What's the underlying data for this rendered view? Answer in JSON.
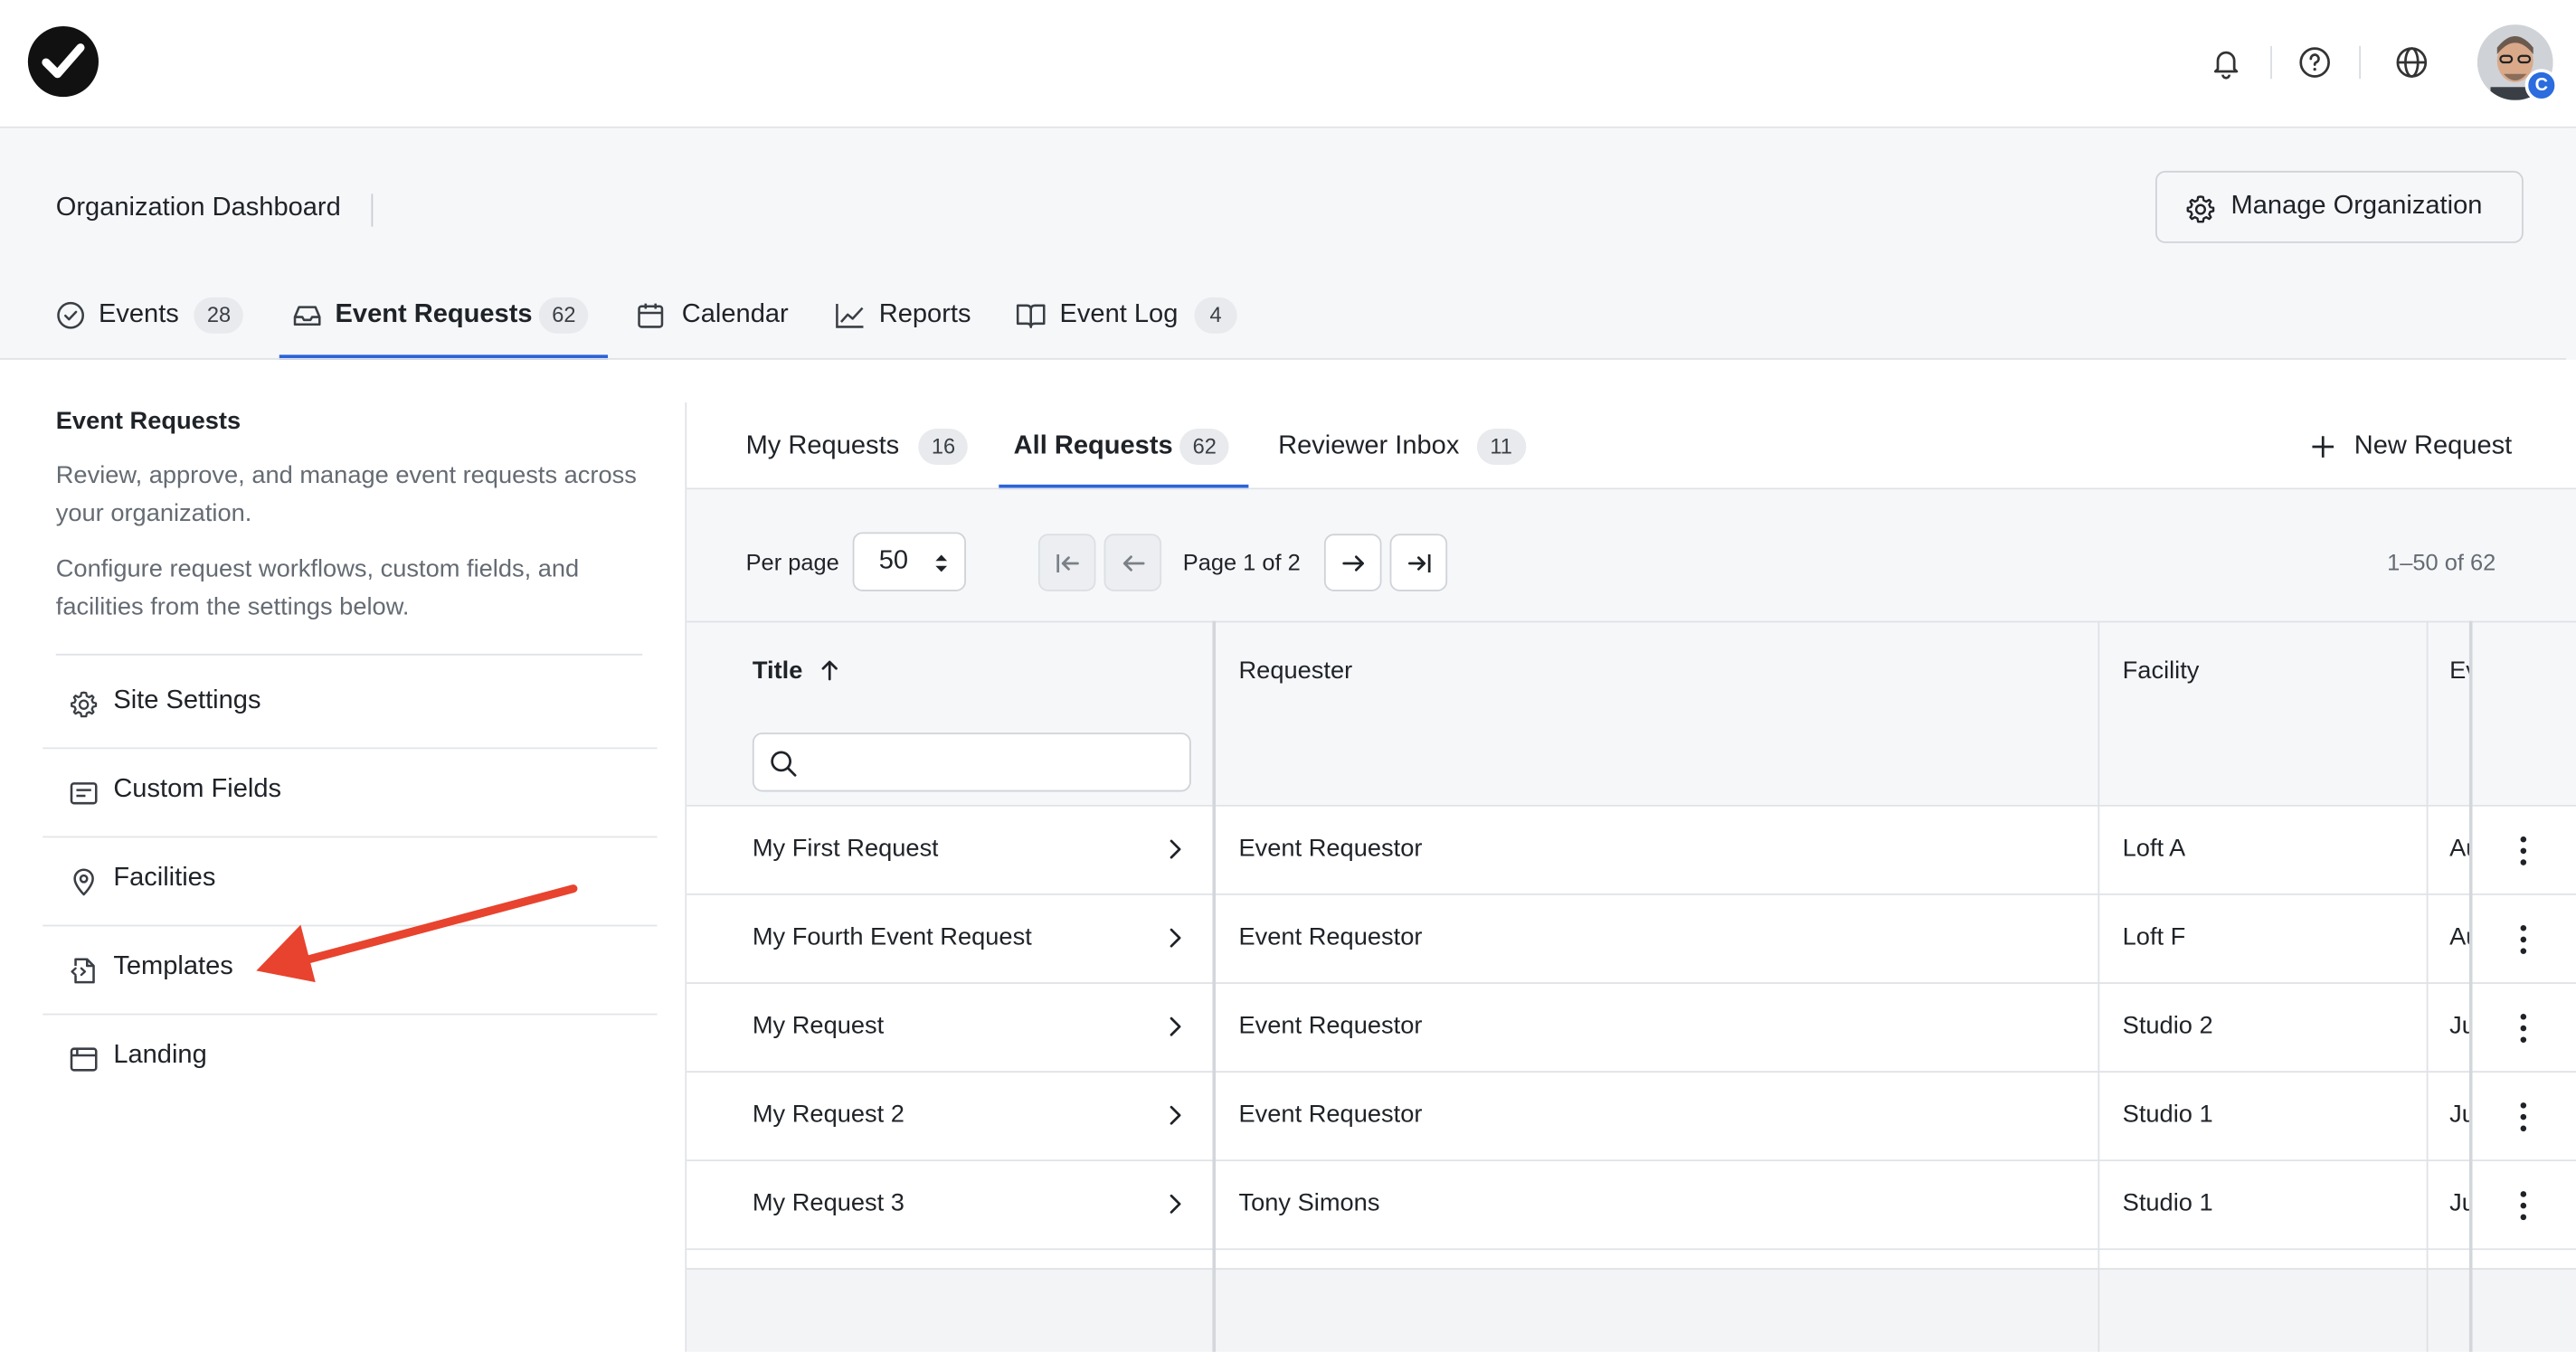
{
  "topbar": {
    "icons": [
      "check-logo-icon",
      "bell-icon",
      "help-icon",
      "globe-icon"
    ],
    "avatar_badge": "C"
  },
  "header": {
    "org_title": "Organization Dashboard",
    "manage_button": "Manage Organization"
  },
  "nav_tabs": [
    {
      "label": "Events",
      "count": "28",
      "icon": "check-circle-icon"
    },
    {
      "label": "Event Requests",
      "count": "62",
      "icon": "inbox-icon",
      "active": true
    },
    {
      "label": "Calendar",
      "icon": "calendar-icon"
    },
    {
      "label": "Reports",
      "icon": "chart-line-icon"
    },
    {
      "label": "Event Log",
      "count": "4",
      "icon": "book-icon"
    }
  ],
  "sidebar": {
    "title": "Event Requests",
    "desc1": "Review, approve, and manage event requests across your organization.",
    "desc2": "Configure request workflows, custom fields, and facilities from the settings below.",
    "items": [
      {
        "label": "Site Settings",
        "icon": "gear-icon"
      },
      {
        "label": "Custom Fields",
        "icon": "form-icon"
      },
      {
        "label": "Facilities",
        "icon": "map-pin-icon"
      },
      {
        "label": "Templates",
        "icon": "template-icon"
      },
      {
        "label": "Landing",
        "icon": "browser-icon"
      }
    ]
  },
  "sub_tabs": [
    {
      "label": "My Requests",
      "count": "16"
    },
    {
      "label": "All Requests",
      "count": "62",
      "active": true
    },
    {
      "label": "Reviewer Inbox",
      "count": "11"
    }
  ],
  "new_request": "New Request",
  "pagination": {
    "per_page_label": "Per page",
    "per_page_value": "50",
    "page_label": "Page 1 of 2",
    "range_label": "1–50 of 62"
  },
  "table": {
    "headers": {
      "title": "Title",
      "requester": "Requester",
      "facility": "Facility",
      "event": "Ev"
    },
    "rows": [
      {
        "title": "My First Request",
        "requester": "Event Requestor",
        "facility": "Loft A",
        "event": "Au"
      },
      {
        "title": "My Fourth Event Request",
        "requester": "Event Requestor",
        "facility": "Loft F",
        "event": "Au"
      },
      {
        "title": "My Request",
        "requester": "Event Requestor",
        "facility": "Studio 2",
        "event": "Ju"
      },
      {
        "title": "My Request 2",
        "requester": "Event Requestor",
        "facility": "Studio 1",
        "event": "Ju"
      },
      {
        "title": "My Request 3",
        "requester": "Tony Simons",
        "facility": "Studio 1",
        "event": "Ju"
      }
    ]
  },
  "colors": {
    "accent": "#2b63d9",
    "annotation_arrow": "#e8432e",
    "panel_bg": "#f6f7f9"
  }
}
